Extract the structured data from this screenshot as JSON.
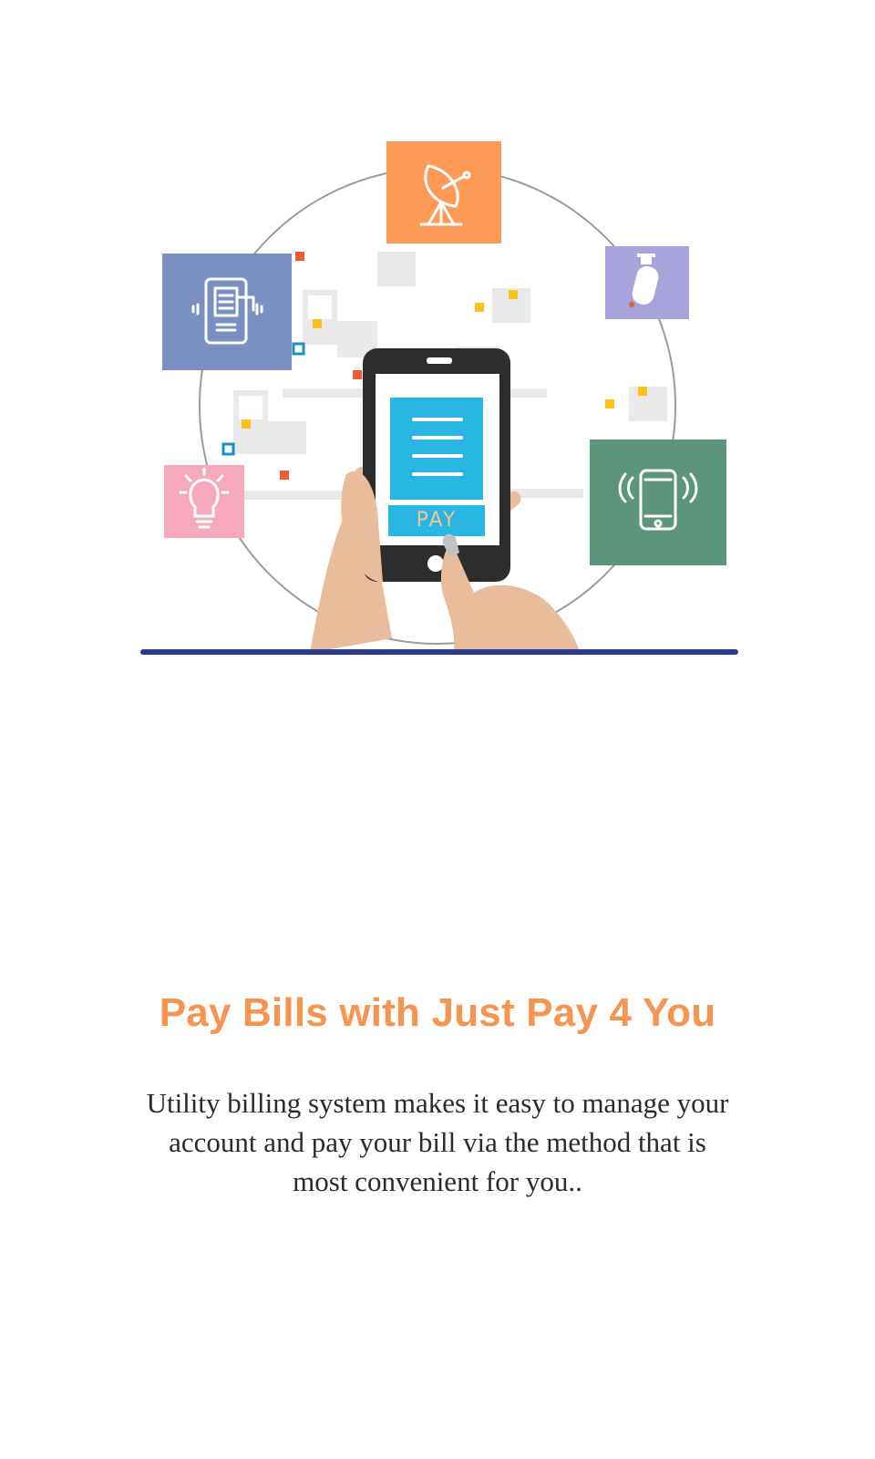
{
  "onboarding": {
    "illustration": {
      "pay_button_label": "PAY",
      "service_icons": [
        "satellite-dish-icon",
        "bill-receipt-phone-icon",
        "gas-cylinder-icon",
        "lightbulb-icon",
        "vibrating-phone-icon"
      ]
    },
    "title": "Pay Bills with Just Pay 4 You",
    "description": "Utility billing system makes it easy to manage your account and pay your bill via the method that is most convenient for you.."
  },
  "colors": {
    "accent": "#f7944f",
    "body_text": "#2b2b2b",
    "ground_line": "#2c3b8c",
    "pay_screen": "#29b6e3",
    "tile_satellite": "#fd9a56",
    "tile_bill": "#7b8fc2",
    "tile_gas": "#a9a3db",
    "tile_bulb": "#f6a8bf",
    "tile_phone": "#5b957b"
  }
}
